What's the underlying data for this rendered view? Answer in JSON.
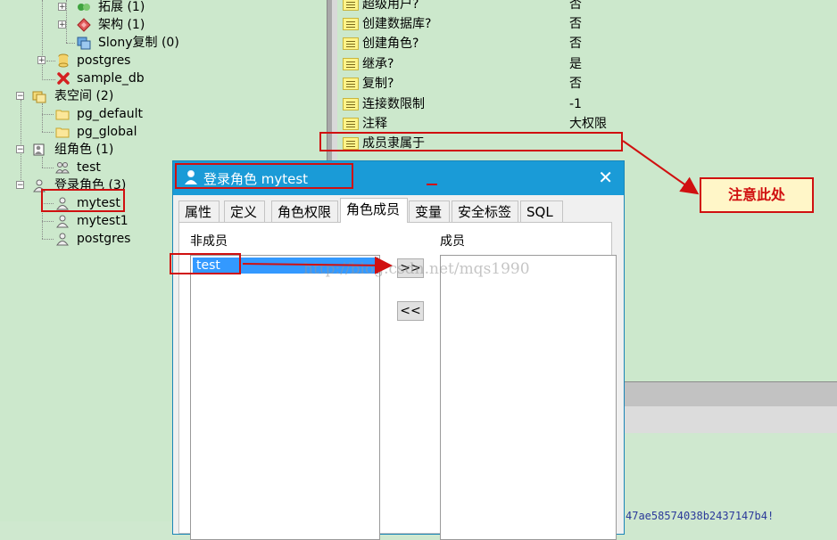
{
  "tree": {
    "items": [
      {
        "id": "ext",
        "label": "拓展 (1)"
      },
      {
        "id": "schema",
        "label": "架构 (1)"
      },
      {
        "id": "slony",
        "label": "Slony复制 (0)"
      },
      {
        "id": "postgres_db",
        "label": "postgres"
      },
      {
        "id": "sample_db",
        "label": "sample_db"
      },
      {
        "id": "tablespaces",
        "label": "表空间 (2)"
      },
      {
        "id": "pg_default",
        "label": "pg_default"
      },
      {
        "id": "pg_global",
        "label": "pg_global"
      },
      {
        "id": "group_roles",
        "label": "组角色 (1)"
      },
      {
        "id": "test",
        "label": "test"
      },
      {
        "id": "login_roles",
        "label": "登录角色 (3)"
      },
      {
        "id": "mytest",
        "label": "mytest"
      },
      {
        "id": "mytest1",
        "label": "mytest1"
      },
      {
        "id": "postgres_role",
        "label": "postgres"
      }
    ]
  },
  "properties": {
    "rows": [
      {
        "name": "超级用户?",
        "value": "否"
      },
      {
        "name": "创建数据库?",
        "value": "否"
      },
      {
        "name": "创建角色?",
        "value": "否"
      },
      {
        "name": "继承?",
        "value": "是"
      },
      {
        "name": "复制?",
        "value": "否"
      },
      {
        "name": "连接数限制",
        "value": "-1"
      },
      {
        "name": "注释",
        "value": "大权限"
      },
      {
        "name": "成员隶属于",
        "value": ""
      }
    ]
  },
  "bottom_hash": "47ae58574038b2437147b4!",
  "dialog": {
    "title": "登录角色 mytest",
    "close_glyph": "✕",
    "tabs": [
      "属性",
      "定义",
      "角色权限",
      "角色成员",
      "变量",
      "安全标签",
      "SQL"
    ],
    "active_tab": "角色成员",
    "nonmember_label": "非成员",
    "member_label": "成员",
    "nonmember_items": [
      "test"
    ],
    "add_button": ">>",
    "remove_button": "<<"
  },
  "annotation": {
    "note": "注意此处"
  },
  "watermark": "http://blog.csdn.net/mqs1990",
  "colors": {
    "titlebar": "#1a9bd7",
    "annotation_red": "#d01010",
    "selection": "#3399ff",
    "background": "#cce8cc"
  }
}
